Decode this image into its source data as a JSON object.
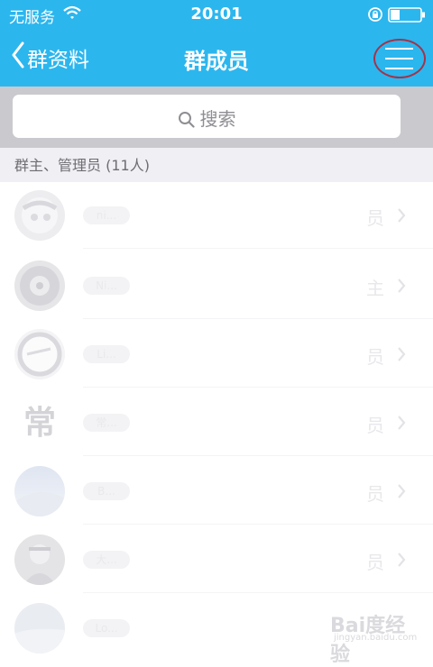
{
  "status_bar": {
    "carrier": "无服务",
    "time": "20:01",
    "icons": [
      "wifi-icon",
      "rotation-lock-icon",
      "battery-icon"
    ]
  },
  "nav": {
    "back_label": "群资料",
    "title": "群成员",
    "menu_icon": "hamburger-menu-icon"
  },
  "search": {
    "placeholder": "搜索"
  },
  "section": {
    "title": "群主、管理员 (11人)"
  },
  "members": [
    {
      "name": "ni...",
      "role": "员"
    },
    {
      "name": "Ni...",
      "role": "主"
    },
    {
      "name": "Li...",
      "role": "员"
    },
    {
      "name": "常...",
      "role": "员"
    },
    {
      "name": "B...",
      "role": "员"
    },
    {
      "name": "大...",
      "role": "员"
    },
    {
      "name": "Lo...",
      "role": ""
    }
  ],
  "watermark": {
    "main": "Bai度经验",
    "sub": "jingyan.baidu.com"
  },
  "colors": {
    "brand": "#2cb6ee",
    "annotation_circle": "#a3344a",
    "search_bar_bg": "#c9c9ce",
    "section_bg": "#efeff4"
  }
}
